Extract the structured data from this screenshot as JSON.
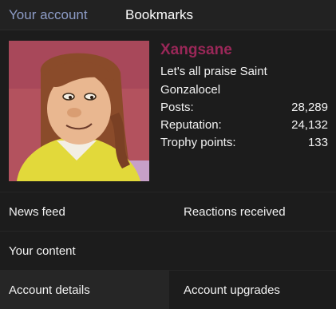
{
  "tabs": {
    "your_account": "Your account",
    "bookmarks": "Bookmarks"
  },
  "profile": {
    "username": "Xangsane",
    "status": "Let's all praise Saint Gonzalocel",
    "stats": [
      {
        "label": "Posts:",
        "value": "28,289"
      },
      {
        "label": "Reputation:",
        "value": "24,132"
      },
      {
        "label": "Trophy points:",
        "value": "133"
      }
    ],
    "avatar_icon": "user-avatar-image"
  },
  "menu": {
    "news_feed": "News feed",
    "reactions_received": "Reactions received",
    "your_content": "Your content",
    "account_details": "Account details",
    "account_upgrades": "Account upgrades"
  },
  "colors": {
    "background": "#1c1c1c",
    "header": "#222222",
    "inactive_tab": "#8d9cc7",
    "username": "#9a2758",
    "highlight": "#262626"
  }
}
